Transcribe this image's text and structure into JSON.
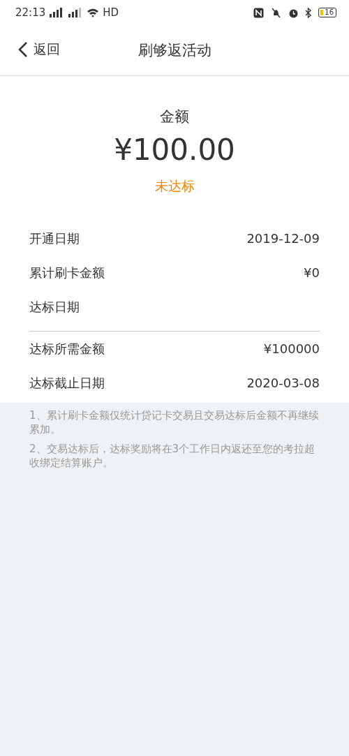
{
  "status_bar": {
    "time": "22:13",
    "network": "HD",
    "battery": "16"
  },
  "header": {
    "back": "返回",
    "title": "刷够返活动"
  },
  "summary": {
    "label": "金额",
    "amount": "¥100.00",
    "status": "未达标"
  },
  "groups": [
    {
      "rows": [
        {
          "label": "开通日期",
          "value": "2019-12-09"
        },
        {
          "label": "累计刷卡金额",
          "value": "¥0"
        },
        {
          "label": "达标日期"
        }
      ]
    },
    {
      "rows": [
        {
          "label": "达标所需金额",
          "value": "¥100000"
        },
        {
          "label": "达标截止日期",
          "value": "2020-03-08"
        }
      ]
    }
  ],
  "notes": [
    "1、累计刷卡金额仅统计贷记卡交易且交易达标后金额不再继续累加。",
    "2、交易达标后，达标奖励将在3个工作日内返还至您的考拉超收绑定结算账户。"
  ]
}
